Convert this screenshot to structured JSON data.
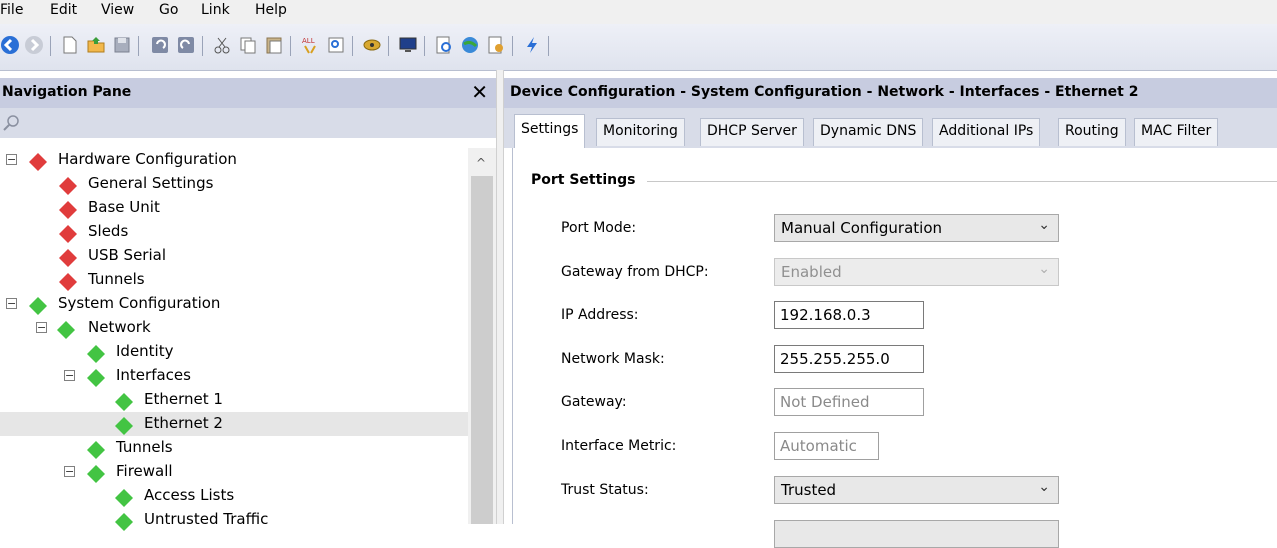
{
  "menu": {
    "items": [
      {
        "label": "File"
      },
      {
        "label": "Edit"
      },
      {
        "label": "View"
      },
      {
        "label": "Go"
      },
      {
        "label": "Link"
      },
      {
        "label": "Help"
      }
    ]
  },
  "navigation": {
    "title": "Navigation Pane",
    "close_icon": "close-icon",
    "search_icon": "search-icon",
    "tree": [
      {
        "label": "Hardware Configuration",
        "color": "#e03c3c",
        "expander": "⊟"
      },
      {
        "label": "General Settings",
        "color": "#e03c3c"
      },
      {
        "label": "Base Unit",
        "color": "#e03c3c"
      },
      {
        "label": "Sleds",
        "color": "#e03c3c"
      },
      {
        "label": "USB Serial",
        "color": "#e03c3c"
      },
      {
        "label": "Tunnels",
        "color": "#e03c3c"
      },
      {
        "label": "System Configuration",
        "color": "#43c443",
        "expander": "⊟"
      },
      {
        "label": "Network",
        "color": "#43c443",
        "expander": "⊟"
      },
      {
        "label": "Identity",
        "color": "#43c443"
      },
      {
        "label": "Interfaces",
        "color": "#43c443",
        "expander": "⊟"
      },
      {
        "label": "Ethernet 1",
        "color": "#43c443"
      },
      {
        "label": "Ethernet 2",
        "color": "#43c443",
        "selected": true
      },
      {
        "label": "Tunnels",
        "color": "#43c443"
      },
      {
        "label": "Firewall",
        "color": "#43c443",
        "expander": "⊟"
      },
      {
        "label": "Access Lists",
        "color": "#43c443"
      },
      {
        "label": "Untrusted Traffic",
        "color": "#43c443"
      }
    ]
  },
  "content": {
    "title": "Device Configuration - System Configuration - Network - Interfaces - Ethernet 2",
    "tabs": [
      {
        "label": "Settings",
        "active": true
      },
      {
        "label": "Monitoring"
      },
      {
        "label": "DHCP Server"
      },
      {
        "label": "Dynamic DNS"
      },
      {
        "label": "Additional IPs"
      },
      {
        "label": "Routing"
      },
      {
        "label": "MAC Filter"
      }
    ],
    "section": "Port Settings",
    "fields": {
      "port_mode": {
        "label": "Port Mode:",
        "value": "Manual Configuration"
      },
      "gateway_dhcp": {
        "label": "Gateway from DHCP:",
        "value": "Enabled"
      },
      "ip_address": {
        "label": "IP Address:",
        "value": "192.168.0.3"
      },
      "network_mask": {
        "label": "Network Mask:",
        "value": "255.255.255.0"
      },
      "gateway": {
        "label": "Gateway:",
        "placeholder": "Not Defined"
      },
      "interface_metric": {
        "label": "Interface Metric:",
        "placeholder": "Automatic"
      },
      "trust_status": {
        "label": "Trust Status:",
        "value": "Trusted"
      }
    }
  },
  "colors": {
    "header_bg": "#c7cce0",
    "selected_row": "#e6e6e6",
    "hardware_diamond": "#e03c3c",
    "system_diamond": "#43c443"
  }
}
